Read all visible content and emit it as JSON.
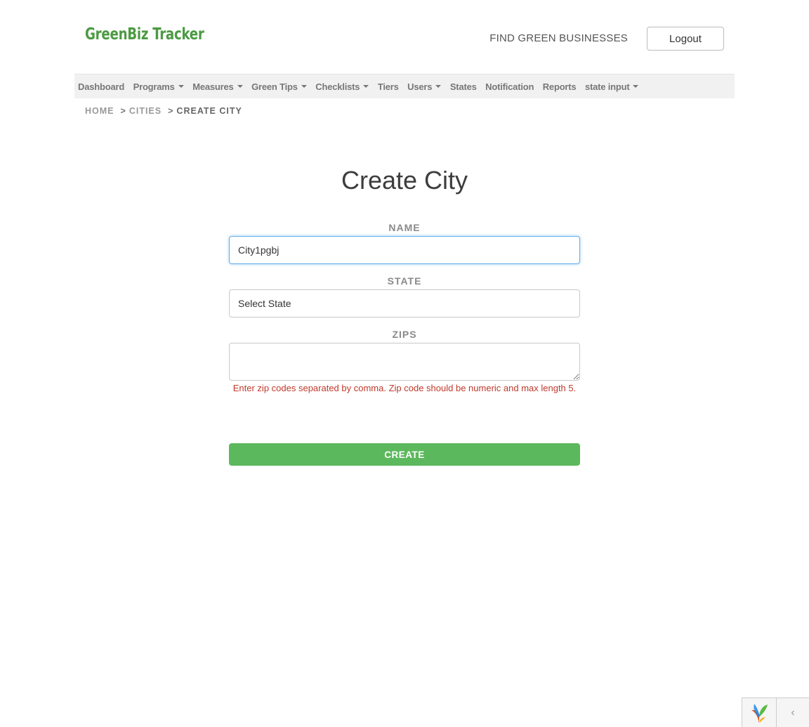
{
  "header": {
    "logo": "GreenBiz Tracker",
    "find_link": "FIND GREEN BUSINESSES",
    "logout_label": "Logout"
  },
  "nav": {
    "items": [
      {
        "label": "Dashboard",
        "dropdown": false
      },
      {
        "label": "Programs",
        "dropdown": true
      },
      {
        "label": "Measures",
        "dropdown": true
      },
      {
        "label": "Green Tips",
        "dropdown": true
      },
      {
        "label": "Checklists",
        "dropdown": true
      },
      {
        "label": "Tiers",
        "dropdown": false
      },
      {
        "label": "Users",
        "dropdown": true
      },
      {
        "label": "States",
        "dropdown": false
      },
      {
        "label": "Notification",
        "dropdown": false
      },
      {
        "label": "Reports",
        "dropdown": false
      },
      {
        "label": "state input",
        "dropdown": true
      }
    ]
  },
  "breadcrumb": {
    "home": "HOME",
    "sep": ">",
    "cities": "CITIES",
    "current": "CREATE CITY"
  },
  "page": {
    "title": "Create City"
  },
  "form": {
    "name_label": "NAME",
    "name_value": "City1pgbj",
    "state_label": "STATE",
    "state_value": "Select State",
    "zips_label": "ZIPS",
    "zips_value": "",
    "zips_help": "Enter zip codes separated by comma. Zip code should be numeric and max length 5.",
    "submit_label": "CREATE"
  },
  "colors": {
    "brand_green": "#4c9a43",
    "button_green": "#5cb85c",
    "error_red": "#c0392b",
    "focus_blue": "#66afe9"
  },
  "debug_toolbar": {
    "logo_icon": "yii-logo-icon",
    "toggle_icon": "chevron-left-icon",
    "toggle_glyph": "‹"
  }
}
